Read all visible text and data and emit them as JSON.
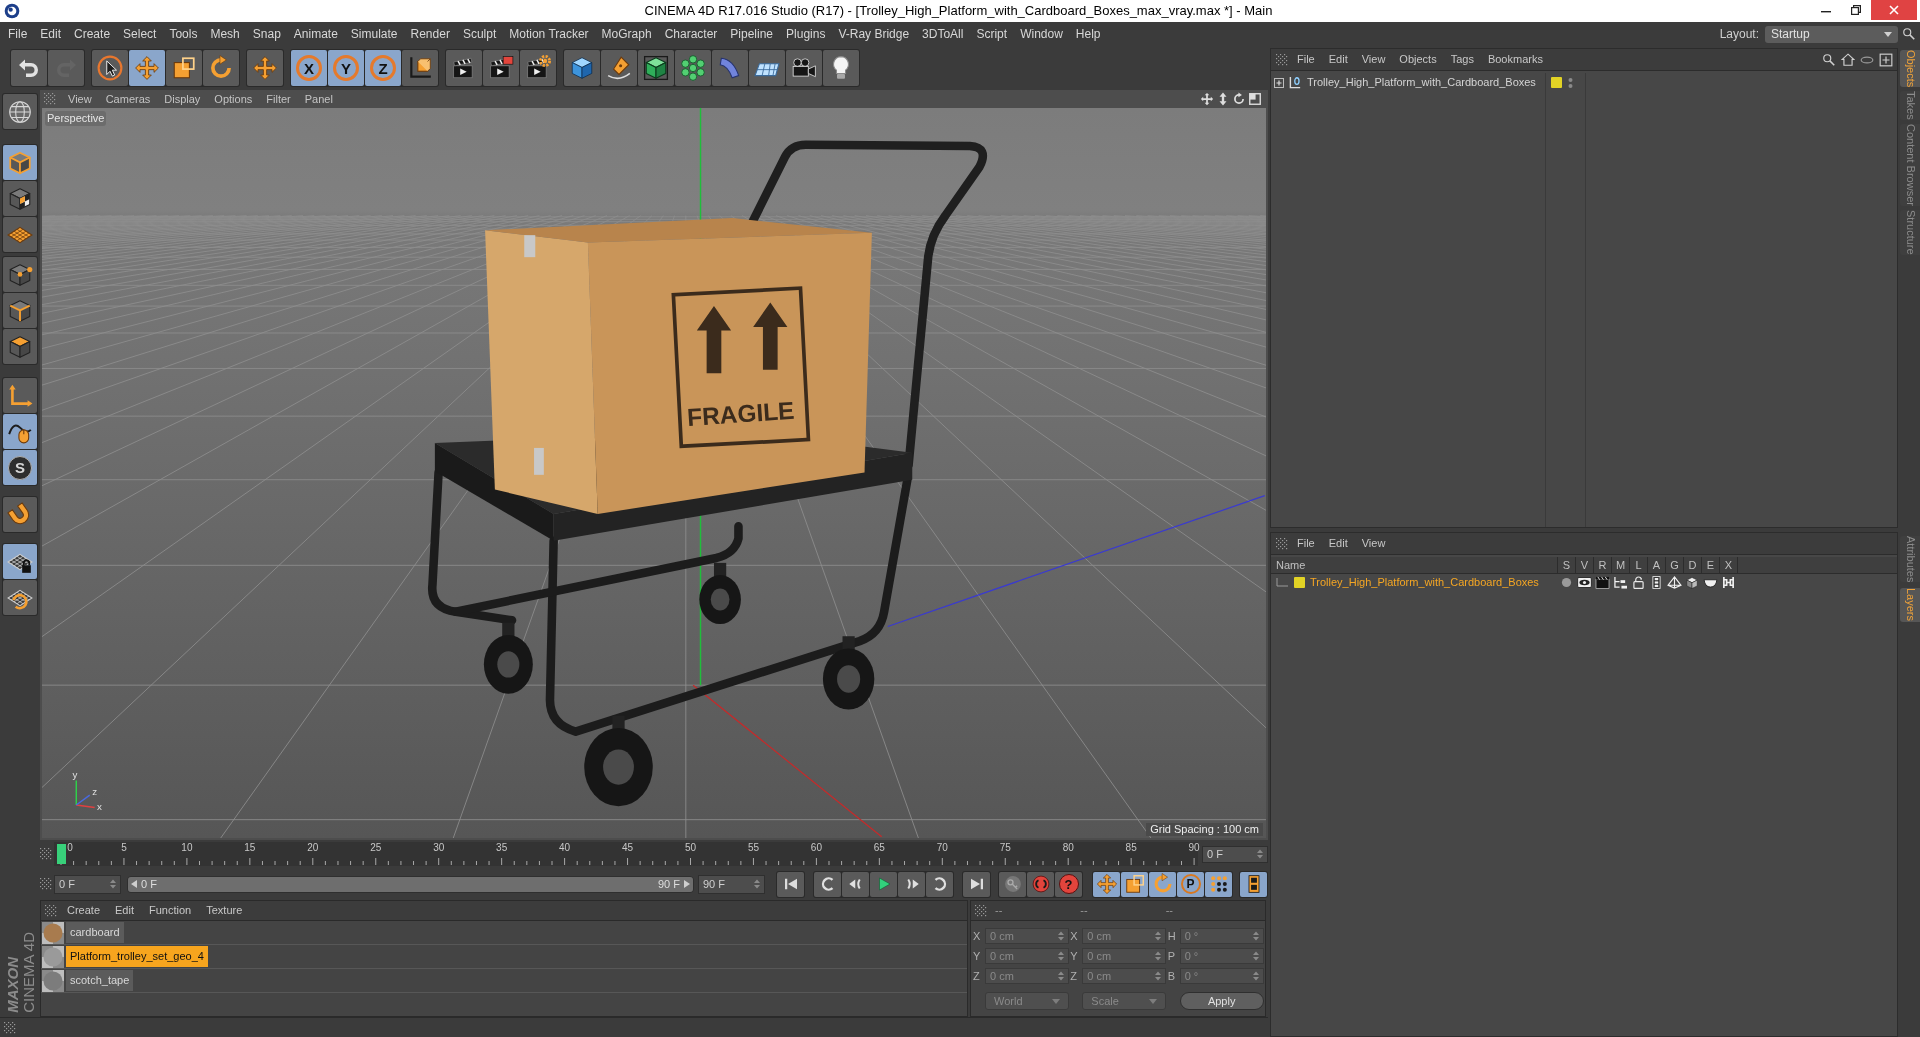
{
  "window": {
    "title": "CINEMA 4D R17.016 Studio (R17) - [Trolley_High_Platform_with_Cardboard_Boxes_max_vray.max *] - Main"
  },
  "menu_bar": [
    "File",
    "Edit",
    "Create",
    "Select",
    "Tools",
    "Mesh",
    "Snap",
    "Animate",
    "Simulate",
    "Render",
    "Sculpt",
    "Motion Tracker",
    "MoGraph",
    "Character",
    "Pipeline",
    "Plugins",
    "V-Ray Bridge",
    "3DToAll",
    "Script",
    "Window",
    "Help"
  ],
  "layout": {
    "label": "Layout:",
    "value": "Startup"
  },
  "main_toolbar": [
    [
      {
        "selected": false,
        "disabled": false
      },
      {
        "selected": false,
        "disabled": true
      }
    ],
    [
      {
        "selected": false,
        "disabled": false
      },
      {
        "selected": true,
        "disabled": false
      },
      {
        "selected": false,
        "disabled": false
      },
      {
        "selected": false,
        "disabled": false
      }
    ],
    [
      {
        "selected": false,
        "disabled": false
      }
    ],
    [
      {
        "label": "X",
        "selected": true,
        "disabled": false
      },
      {
        "label": "Y",
        "selected": true,
        "disabled": false
      },
      {
        "label": "Z",
        "selected": true,
        "disabled": false
      },
      {
        "selected": false,
        "disabled": false
      }
    ],
    [
      {
        "selected": false,
        "disabled": false
      },
      {
        "selected": false,
        "disabled": false
      },
      {
        "selected": false,
        "disabled": false
      }
    ],
    [
      {
        "selected": false,
        "disabled": false
      },
      {
        "selected": false,
        "disabled": false
      },
      {
        "selected": false,
        "disabled": false
      },
      {
        "selected": false,
        "disabled": false
      },
      {
        "selected": false,
        "disabled": false
      },
      {
        "selected": false,
        "disabled": false
      },
      {
        "selected": false,
        "disabled": false
      },
      {
        "selected": false,
        "disabled": false
      }
    ]
  ],
  "tool_palette": [
    [
      {
        "selected": false
      }
    ],
    [
      {
        "selected": true
      },
      {
        "selected": false
      },
      {
        "selected": false
      }
    ],
    [
      {
        "selected": false
      },
      {
        "selected": false
      },
      {
        "selected": false
      }
    ],
    [
      {
        "selected": false
      },
      {
        "selected": true
      },
      {
        "label": "S",
        "selected": true
      }
    ],
    [
      {
        "selected": false
      }
    ],
    [
      {
        "selected": true
      },
      {
        "selected": false
      }
    ]
  ],
  "viewport": {
    "menu": [
      "View",
      "Cameras",
      "Display",
      "Options",
      "Filter",
      "Panel"
    ],
    "camera": "Perspective",
    "box_print": "FRAGILE",
    "axis_labels": [
      "y",
      "x",
      "z"
    ],
    "grid_spacing": "Grid Spacing : 100 cm"
  },
  "timeline": {
    "frame_labels": [
      "0",
      "5",
      "10",
      "15",
      "20",
      "25",
      "30",
      "35",
      "40",
      "45",
      "50",
      "55",
      "60",
      "65",
      "70",
      "75",
      "80",
      "85",
      "90"
    ],
    "playhead": {
      "level": 0
    },
    "current_frame": "0 F"
  },
  "playback": {
    "start_field": "0 F",
    "range": {
      "start": "0 F",
      "end": "90 F",
      "level": 1
    },
    "end_field": "90 F",
    "buttons": [
      [
        {
          "selected": false
        }
      ],
      [
        {
          "selected": false
        },
        {
          "selected": false
        },
        {
          "selected": false
        },
        {
          "selected": false
        },
        {
          "selected": false
        }
      ],
      [
        {
          "selected": false
        }
      ],
      [
        {
          "selected": false
        },
        {
          "selected": false
        },
        {
          "label": "?",
          "selected": false
        }
      ],
      [
        {
          "selected": true
        },
        {
          "selected": true
        },
        {
          "selected": true
        },
        {
          "label": "P",
          "selected": true
        },
        {
          "selected": true
        }
      ],
      [
        {
          "selected": true
        }
      ]
    ]
  },
  "material_manager": {
    "menu": [
      "Create",
      "Edit",
      "Function",
      "Texture"
    ],
    "materials": [
      {
        "name": "cardboard",
        "color": "#a87b4e",
        "selected": false
      },
      {
        "name": "Platform_trolley_set_geo_4",
        "color": "#9a9a9a",
        "selected": true
      },
      {
        "name": "scotch_tape",
        "color": "#7c7c7c",
        "selected": false
      }
    ]
  },
  "coordinates": {
    "disabled": true,
    "headers": [
      "--",
      "--",
      "--"
    ],
    "rows": [
      [
        {
          "axis": "X",
          "value": "0 cm"
        },
        {
          "axis": "X",
          "value": "0 cm"
        },
        {
          "axis": "H",
          "value": "0 °"
        }
      ],
      [
        {
          "axis": "Y",
          "value": "0 cm"
        },
        {
          "axis": "Y",
          "value": "0 cm"
        },
        {
          "axis": "P",
          "value": "0 °"
        }
      ],
      [
        {
          "axis": "Z",
          "value": "0 cm"
        },
        {
          "axis": "Z",
          "value": "0 cm"
        },
        {
          "axis": "B",
          "value": "0 °"
        }
      ]
    ],
    "dropdowns": [
      "World",
      "Scale"
    ],
    "apply": "Apply"
  },
  "logo": {
    "brand": "MAXON",
    "product": "CINEMA 4D"
  },
  "object_manager": {
    "menu": [
      "File",
      "Edit",
      "View",
      "Objects",
      "Tags",
      "Bookmarks"
    ],
    "objects": [
      {
        "name": "Trolley_High_Platform_with_Cardboard_Boxes",
        "expanded": false,
        "color": "#e2d325"
      }
    ]
  },
  "side_tabs_top": [
    {
      "label": "Objects",
      "selected": true
    },
    {
      "label": "Takes",
      "selected": false
    },
    {
      "label": "Content Browser",
      "selected": false
    },
    {
      "label": "Structure",
      "selected": false
    }
  ],
  "layer_manager": {
    "menu": [
      "File",
      "Edit",
      "View"
    ],
    "columns": [
      "Name",
      "S",
      "V",
      "R",
      "M",
      "L",
      "A",
      "G",
      "D",
      "E",
      "X"
    ],
    "layers": [
      {
        "name": "Trolley_High_Platform_with_Cardboard_Boxes",
        "color": "#e2d325",
        "selected": true,
        "switches": [
          {
            "on": false
          },
          {
            "on": true
          },
          {
            "on": true
          },
          {
            "on": true
          },
          {
            "on": false
          },
          {
            "on": true
          },
          {
            "on": true
          },
          {
            "on": true
          },
          {
            "on": true
          },
          {
            "on": true
          }
        ]
      }
    ]
  },
  "side_tabs_bottom": [
    {
      "label": "Attributes",
      "selected": false
    },
    {
      "label": "Layers",
      "selected": true
    }
  ]
}
